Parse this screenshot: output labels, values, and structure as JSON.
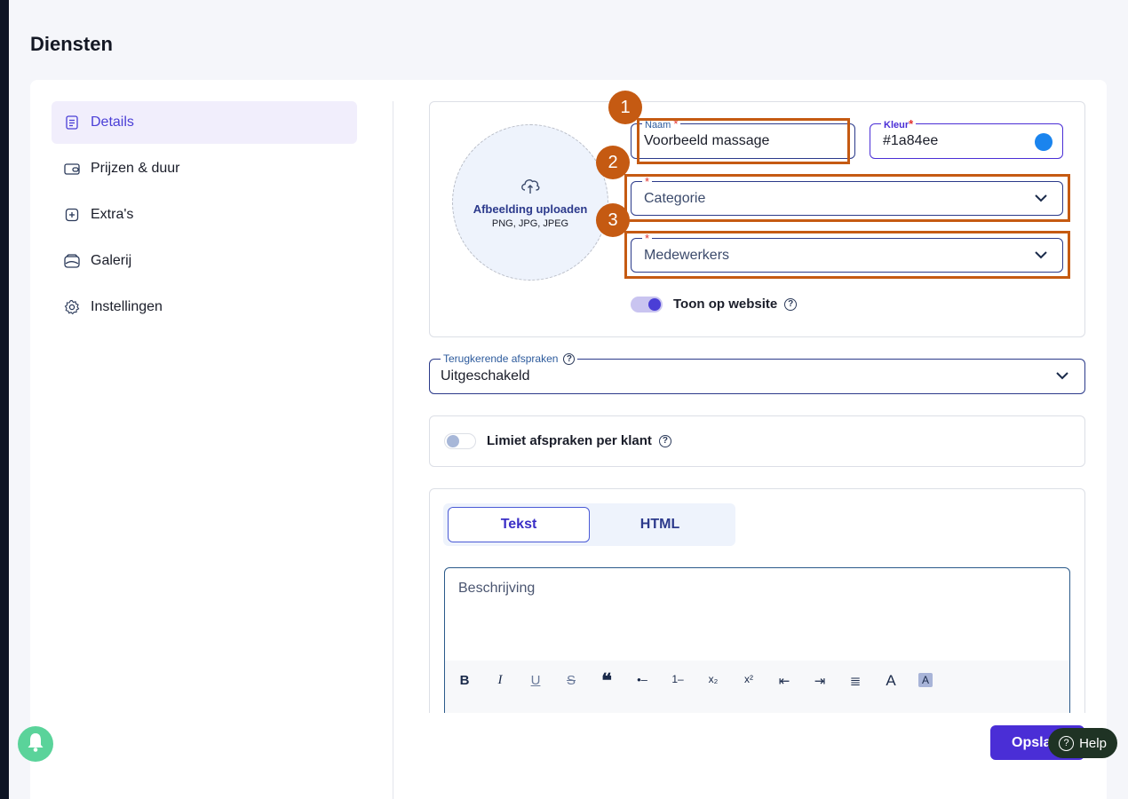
{
  "page": {
    "title": "Diensten"
  },
  "sidebar": {
    "items": [
      {
        "label": "Details",
        "icon": "document-icon",
        "active": true
      },
      {
        "label": "Prijzen & duur",
        "icon": "wallet-icon",
        "active": false
      },
      {
        "label": "Extra's",
        "icon": "plus-square-icon",
        "active": false
      },
      {
        "label": "Galerij",
        "icon": "gallery-icon",
        "active": false
      },
      {
        "label": "Instellingen",
        "icon": "gear-icon",
        "active": false
      }
    ]
  },
  "upload": {
    "title": "Afbeelding uploaden",
    "formats": "PNG, JPG, JPEG",
    "icon": "cloud-upload-icon"
  },
  "form": {
    "name": {
      "label": "Naam",
      "required_mark": "*",
      "value": "Voorbeeld massage"
    },
    "color": {
      "label": "Kleur",
      "required_mark": "*",
      "value": "#1a84ee",
      "swatch": "#1a84ee"
    },
    "category": {
      "placeholder": "Categorie",
      "required_mark": "*"
    },
    "employees": {
      "placeholder": "Medewerkers",
      "required_mark": "*"
    },
    "show_on_website": {
      "label": "Toon op website",
      "enabled": true
    },
    "recurring": {
      "label": "Terugkerende afspraken",
      "value": "Uitgeschakeld"
    },
    "limit_per_client": {
      "label": "Limiet afspraken per klant",
      "enabled": false
    }
  },
  "annotations": {
    "badges": [
      "1",
      "2",
      "3"
    ],
    "highlight_color": "#c55a12"
  },
  "editor": {
    "tabs": [
      {
        "label": "Tekst",
        "active": true
      },
      {
        "label": "HTML",
        "active": false
      }
    ],
    "placeholder": "Beschrijving",
    "toolbar": [
      "B",
      "I",
      "U",
      "S",
      "❝",
      "•–",
      "1–",
      "x₂",
      "x²",
      "⇤",
      "⇥",
      "≣",
      "A",
      "A"
    ]
  },
  "actions": {
    "save_label": "Opsla",
    "help_label": "Help"
  },
  "colors": {
    "accent": "#4a2ed6",
    "active_bg": "#f1eefc",
    "toggle_on": "#4a3ed6"
  }
}
